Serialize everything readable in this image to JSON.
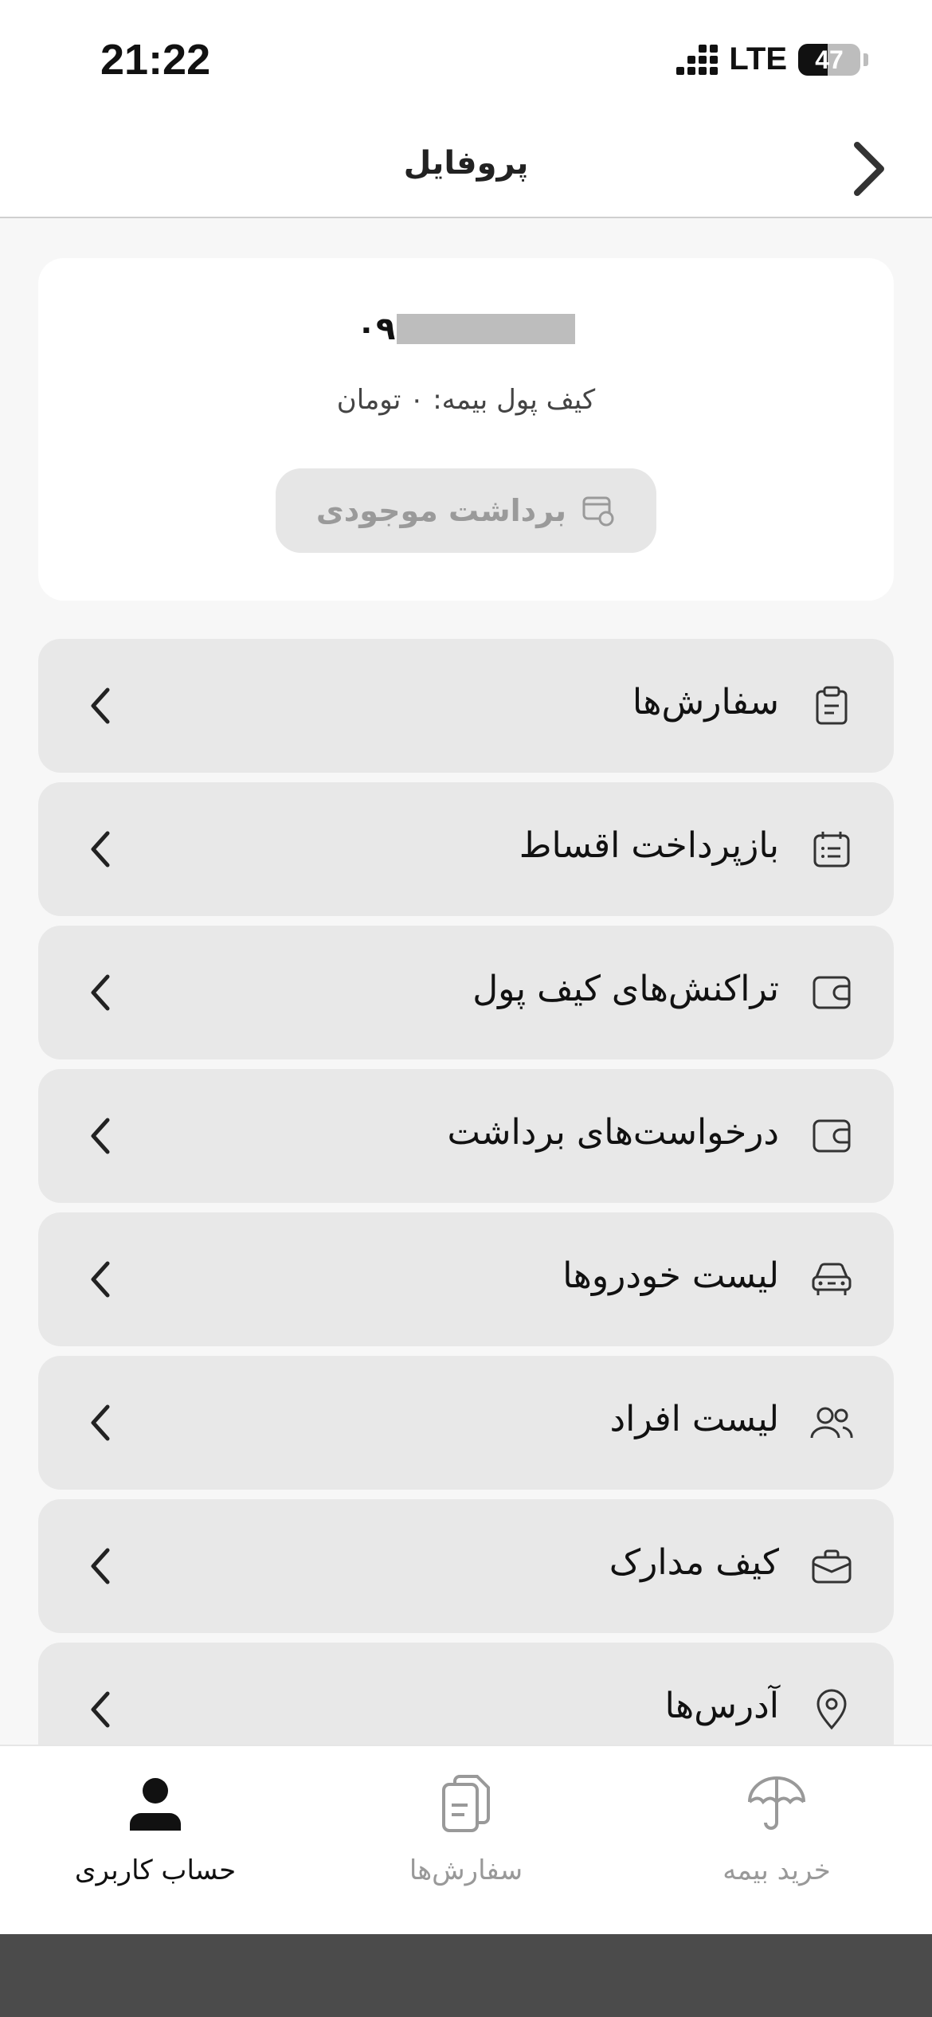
{
  "status_bar": {
    "time": "21:22",
    "network": "LTE",
    "battery": "47",
    "battery_level_percent": 47
  },
  "header": {
    "title": "پروفایل",
    "back_icon": "chevron-right-icon"
  },
  "wallet": {
    "phone_prefix": "۰۹",
    "balance_text": "کیف پول بیمه: ۰ تومان",
    "withdraw_label": "برداشت موجودی"
  },
  "menu": {
    "items": [
      {
        "label": "سفارش‌ها",
        "icon": "clipboard-icon"
      },
      {
        "label": "بازپرداخت اقساط",
        "icon": "calendar-list-icon"
      },
      {
        "label": "تراکنش‌های کیف پول",
        "icon": "wallet-icon"
      },
      {
        "label": "درخواست‌های برداشت",
        "icon": "wallet-icon"
      },
      {
        "label": "لیست خودروها",
        "icon": "car-icon"
      },
      {
        "label": "لیست افراد",
        "icon": "users-icon"
      },
      {
        "label": "کیف مدارک",
        "icon": "briefcase-icon"
      },
      {
        "label": "آدرس‌ها",
        "icon": "map-pin-icon"
      }
    ]
  },
  "bottom_nav": {
    "items": [
      {
        "label": "خرید بیمه",
        "icon": "umbrella-icon",
        "active": false
      },
      {
        "label": "سفارش‌ها",
        "icon": "documents-icon",
        "active": false
      },
      {
        "label": "حساب کاربری",
        "icon": "user-icon",
        "active": true
      }
    ]
  },
  "colors": {
    "card_bg": "#ffffff",
    "menu_item_bg": "#e8e8e8",
    "page_bg": "#f7f7f7",
    "muted_text": "#999999",
    "home_area": "#4b4b4b"
  }
}
